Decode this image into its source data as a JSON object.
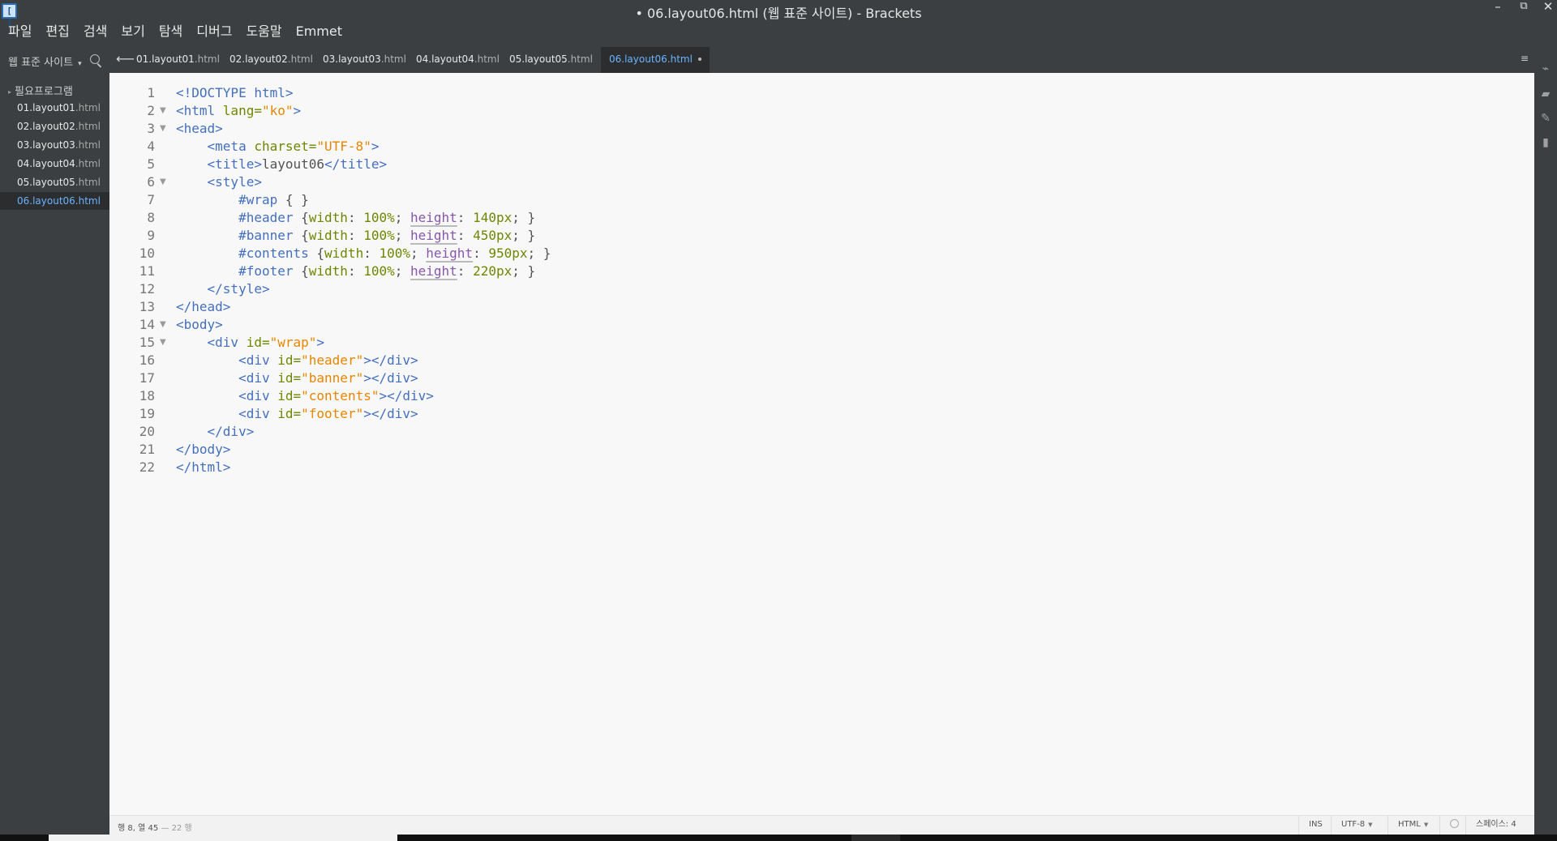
{
  "window": {
    "title": "• 06.layout06.html (웹 표준 사이트) - Brackets",
    "app_icon_glyph": "[ ]",
    "controls": {
      "minimize": "–",
      "maximize": "⧉",
      "close": "✕"
    }
  },
  "menu": [
    "파일",
    "편집",
    "검색",
    "보기",
    "탐색",
    "디버그",
    "도움말",
    "Emmet"
  ],
  "sidebar": {
    "project_name": "웹 표준 사이트",
    "project_caret": "▾",
    "folder": "필요프로그램",
    "folder_caret": "▸",
    "files": [
      {
        "base": "01.layout01",
        "ext": ".html",
        "selected": false
      },
      {
        "base": "02.layout02",
        "ext": ".html",
        "selected": false
      },
      {
        "base": "03.layout03",
        "ext": ".html",
        "selected": false
      },
      {
        "base": "04.layout04",
        "ext": ".html",
        "selected": false
      },
      {
        "base": "05.layout05",
        "ext": ".html",
        "selected": false
      },
      {
        "base": "06.layout06",
        "ext": ".html",
        "selected": true
      }
    ]
  },
  "tabs": {
    "back_glyph": "⟵",
    "menu_glyph": "≡",
    "items": [
      {
        "base": "01.layout01",
        "ext": ".html",
        "active": false
      },
      {
        "base": "02.layout02",
        "ext": ".html",
        "active": false
      },
      {
        "base": "03.layout03",
        "ext": ".html",
        "active": false
      },
      {
        "base": "04.layout04",
        "ext": ".html",
        "active": false
      },
      {
        "base": "05.layout05",
        "ext": ".html",
        "active": false
      },
      {
        "base": "06.layout06",
        "ext": ".html",
        "active": true,
        "dirty": true
      }
    ]
  },
  "editor": {
    "line_numbers": [
      "1",
      "2",
      "3",
      "4",
      "5",
      "6",
      "7",
      "8",
      "9",
      "10",
      "11",
      "12",
      "13",
      "14",
      "15",
      "16",
      "17",
      "18",
      "19",
      "20",
      "21",
      "22"
    ],
    "fold_marker": "▼",
    "code": {
      "l1_tag": "<!DOCTYPE html>",
      "l2_open": "<html ",
      "l2_attr": "lang=",
      "l2_val": "\"ko\"",
      "l2_close": ">",
      "l3_tag": "<head>",
      "l4_open": "<meta ",
      "l4_attr": "charset=",
      "l4_val": "\"UTF-8\"",
      "l4_close": ">",
      "l5_open": "<title>",
      "l5_text": "layout06",
      "l5_close": "</title>",
      "l6_tag": "<style>",
      "l7_sel": "#wrap",
      "l7_rest": " { }",
      "l8_sel": "#header",
      "l8_rest": " {",
      "l9_sel": "#banner",
      "l9_rest": " {",
      "l10_sel": "#contents",
      "l10_rest": " {",
      "l11_sel": "#footer",
      "l11_rest": " {",
      "prop_width": "width",
      "colon": ": ",
      "val_100": "100%",
      "semi": "; ",
      "prop_height": "height",
      "h140": "140px",
      "h450": "450px",
      "h950": "950px",
      "h220": "220px",
      "end_rule": "; }",
      "l12_tag": "</style>",
      "l13_tag": "</head>",
      "l14_tag": "<body>",
      "div_open": "<div ",
      "id_attr": "id=",
      "div_end": "></div>",
      "gt": ">",
      "l15_val": "\"wrap\"",
      "l16_val": "\"header\"",
      "l17_val": "\"banner\"",
      "l18_val": "\"contents\"",
      "l19_val": "\"footer\"",
      "l20_tag": "</div>",
      "l21_tag": "</body>",
      "l22_tag": "</html>"
    }
  },
  "statusbar": {
    "cursor": "행 8, 열 45",
    "line_count": "— 22 행",
    "mode": "INS",
    "encoding": "UTF-8",
    "language": "HTML",
    "indent": "스페이스: 4",
    "caret_glyph": "▼"
  },
  "right_toolbar": {
    "live_preview_glyph": "⌁",
    "extensions_glyph": "▰",
    "wand_glyph": "✎",
    "book_glyph": "▮"
  }
}
